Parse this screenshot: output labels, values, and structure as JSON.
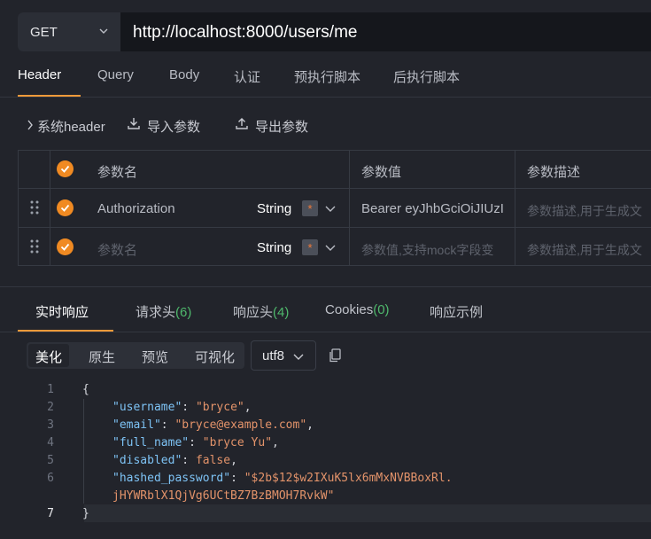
{
  "request": {
    "method": "GET",
    "url": "http://localhost:8000/users/me"
  },
  "tabs": [
    {
      "label": "Header",
      "active": true
    },
    {
      "label": "Query"
    },
    {
      "label": "Body"
    },
    {
      "label": "认证"
    },
    {
      "label": "预执行脚本"
    },
    {
      "label": "后执行脚本"
    }
  ],
  "tools": {
    "system_header": "系统header",
    "import": "导入参数",
    "export": "导出参数"
  },
  "table": {
    "headers": {
      "name": "参数名",
      "value": "参数值",
      "desc": "参数描述"
    },
    "rows": [
      {
        "name": "Authorization",
        "type": "String",
        "required": "*",
        "value": "Bearer eyJhbGciOiJIUzI",
        "desc": "参数描述,用于生成文"
      },
      {
        "name": "参数名",
        "type": "String",
        "required": "*",
        "value": "参数值,支持mock字段变",
        "desc": "参数描述,用于生成文"
      }
    ]
  },
  "response": {
    "tabs": [
      {
        "label": "实时响应",
        "active": true
      },
      {
        "label": "请求头",
        "count": "(6)"
      },
      {
        "label": "响应头",
        "count": "(4)"
      },
      {
        "label": "Cookies",
        "count": "(0)"
      },
      {
        "label": "响应示例"
      }
    ],
    "views": [
      "美化",
      "原生",
      "预览",
      "可视化"
    ],
    "encoding": "utf8",
    "line_numbers": [
      "1",
      "2",
      "3",
      "4",
      "5",
      "6",
      "7"
    ],
    "json": {
      "open": "{",
      "close": "}",
      "username_key": "\"username\"",
      "username_val": "\"bryce\"",
      "email_key": "\"email\"",
      "email_val": "\"bryce@example.com\"",
      "full_name_key": "\"full_name\"",
      "full_name_val": "\"bryce Yu\"",
      "disabled_key": "\"disabled\"",
      "disabled_val": "false",
      "hashed_key": "\"hashed_password\"",
      "hashed_val_1": "\"$2b$12$w2IXuK5lx6mMxNVBBoxRl.",
      "hashed_val_2": "jHYWRblX1QjVg6UCtBZ7BzBMOH7RvkW\""
    }
  },
  "colors": {
    "accent": "#f08a22",
    "background": "#22242b",
    "count": "#4fb86c"
  }
}
